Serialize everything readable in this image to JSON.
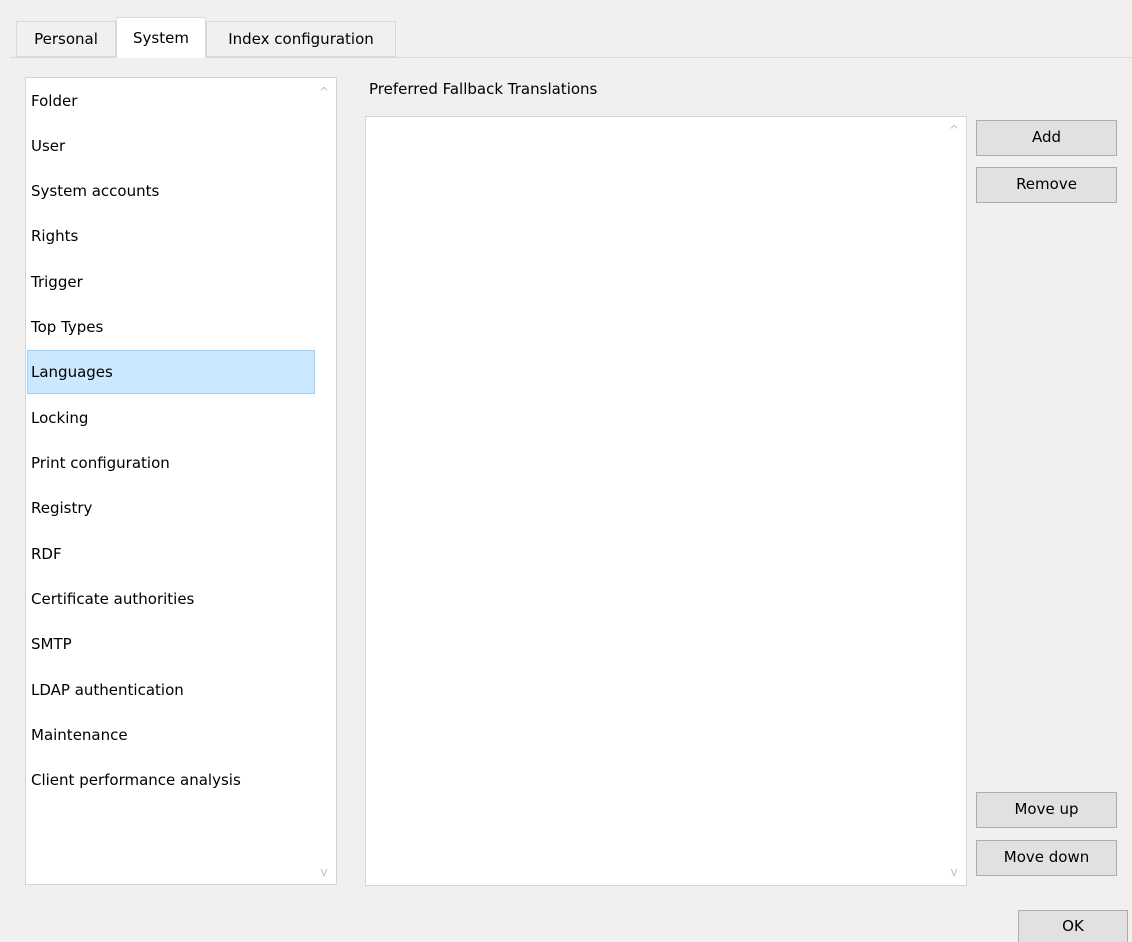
{
  "tabs": [
    {
      "label": "Personal",
      "selected": false
    },
    {
      "label": "System",
      "selected": true
    },
    {
      "label": "Index configuration",
      "selected": false
    }
  ],
  "category_list": {
    "items": [
      {
        "label": "Folder"
      },
      {
        "label": "User"
      },
      {
        "label": "System accounts"
      },
      {
        "label": "Rights"
      },
      {
        "label": "Trigger"
      },
      {
        "label": "Top Types"
      },
      {
        "label": "Languages"
      },
      {
        "label": "Locking"
      },
      {
        "label": "Print configuration"
      },
      {
        "label": "Registry"
      },
      {
        "label": "RDF"
      },
      {
        "label": "Certificate authorities"
      },
      {
        "label": "SMTP"
      },
      {
        "label": "LDAP authentication"
      },
      {
        "label": "Maintenance"
      },
      {
        "label": "Client performance analysis"
      }
    ],
    "selected_label": "Languages",
    "scroll_up_glyph": "^",
    "scroll_down_glyph": "v"
  },
  "fallback_panel": {
    "title": "Preferred Fallback Translations",
    "items": [],
    "scroll_up_glyph": "^",
    "scroll_down_glyph": "v"
  },
  "buttons": {
    "add": "Add",
    "remove": "Remove",
    "move_up": "Move up",
    "move_down": "Move down",
    "ok": "OK"
  },
  "colors": {
    "window_bg": "#f0f0f0",
    "selection_bg": "#cce8ff",
    "selection_border": "#99d1ff",
    "button_bg": "#e1e1e1",
    "button_border": "#adadad"
  }
}
